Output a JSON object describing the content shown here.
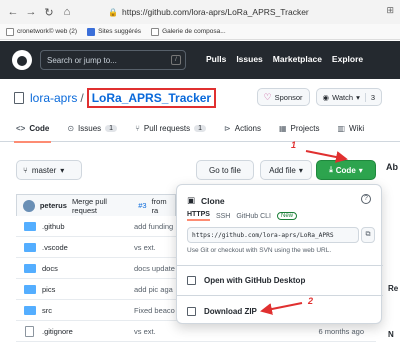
{
  "browser": {
    "url": "https://github.com/lora-aprs/LoRa_APRS_Tracker",
    "bookmarks": [
      {
        "label": "cronetwork© web (2)"
      },
      {
        "label": "Sites suggérés"
      },
      {
        "label": "Galerie de composa..."
      }
    ]
  },
  "header": {
    "search_placeholder": "Search or jump to...",
    "search_kbd": "/",
    "nav": [
      "Pulls",
      "Issues",
      "Marketplace",
      "Explore"
    ]
  },
  "repo": {
    "owner": "lora-aprs",
    "separator": "/",
    "name": "LoRa_APRS_Tracker",
    "sponsor_label": "Sponsor",
    "watch_label": "Watch",
    "watch_count": "3"
  },
  "tabs": [
    {
      "label": "Code",
      "icon": "code-icon",
      "active": true
    },
    {
      "label": "Issues",
      "count": "1",
      "icon": "issue-icon"
    },
    {
      "label": "Pull requests",
      "count": "1",
      "icon": "pull-request-icon"
    },
    {
      "label": "Actions",
      "icon": "play-icon"
    },
    {
      "label": "Projects",
      "icon": "project-icon"
    },
    {
      "label": "Wiki",
      "icon": "book-icon"
    }
  ],
  "toolbar": {
    "branch": "master",
    "go_to_file": "Go to file",
    "add_file": "Add file",
    "code": "Code",
    "about_partial": "Ab"
  },
  "commit": {
    "author": "peterus",
    "message": "Merge pull request",
    "link": "#3",
    "suffix": "from ra"
  },
  "files": [
    {
      "name": ".github",
      "type": "dir",
      "message": "add funding",
      "time": ""
    },
    {
      "name": ".vscode",
      "type": "dir",
      "message": "vs ext.",
      "time": ""
    },
    {
      "name": "docs",
      "type": "dir",
      "message": "docs update",
      "time": ""
    },
    {
      "name": "pics",
      "type": "dir",
      "message": "add pic aga",
      "time": ""
    },
    {
      "name": "src",
      "type": "dir",
      "message": "Fixed beaco",
      "time": ""
    },
    {
      "name": ".gitignore",
      "type": "file",
      "message": "vs ext.",
      "time": "6 months ago"
    }
  ],
  "clone_popup": {
    "title": "Clone",
    "help": "?",
    "protocols": [
      "HTTPS",
      "SSH",
      "GitHub CLI"
    ],
    "new_badge": "New",
    "url": "https://github.com/lora-aprs/LoRa_APRS",
    "hint": "Use Git or checkout with SVN using the web URL.",
    "open_desktop": "Open with GitHub Desktop",
    "download_zip": "Download ZIP"
  },
  "annotations": {
    "step1": "1",
    "step2": "2",
    "color": "#e03030"
  },
  "side_partial": {
    "r": "Re",
    "n": "N"
  }
}
